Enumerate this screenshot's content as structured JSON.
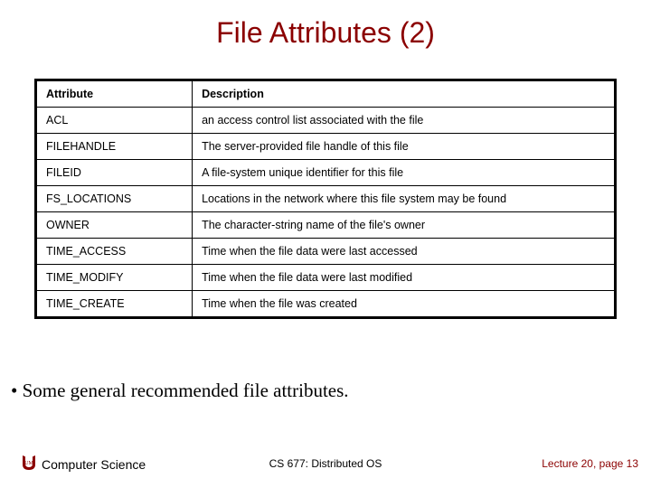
{
  "title": "File Attributes (2)",
  "table": {
    "headers": {
      "col1": "Attribute",
      "col2": "Description"
    },
    "rows": [
      {
        "attr": "ACL",
        "desc": "an access control list associated with the file"
      },
      {
        "attr": "FILEHANDLE",
        "desc": "The server-provided file handle of this file"
      },
      {
        "attr": "FILEID",
        "desc": "A file-system unique identifier for this file"
      },
      {
        "attr": "FS_LOCATIONS",
        "desc": "Locations in the network where this file system may be found"
      },
      {
        "attr": "OWNER",
        "desc": "The character-string name of the file's owner"
      },
      {
        "attr": "TIME_ACCESS",
        "desc": "Time when the file data were last accessed"
      },
      {
        "attr": "TIME_MODIFY",
        "desc": "Time when the file data were last modified"
      },
      {
        "attr": "TIME_CREATE",
        "desc": "Time when the file was created"
      }
    ]
  },
  "bullet": "•  Some general recommended file attributes.",
  "footer": {
    "dept": "Computer Science",
    "course": "CS 677: Distributed OS",
    "pageline": "Lecture 20, page 13"
  },
  "colors": {
    "accent": "#8b0000"
  }
}
